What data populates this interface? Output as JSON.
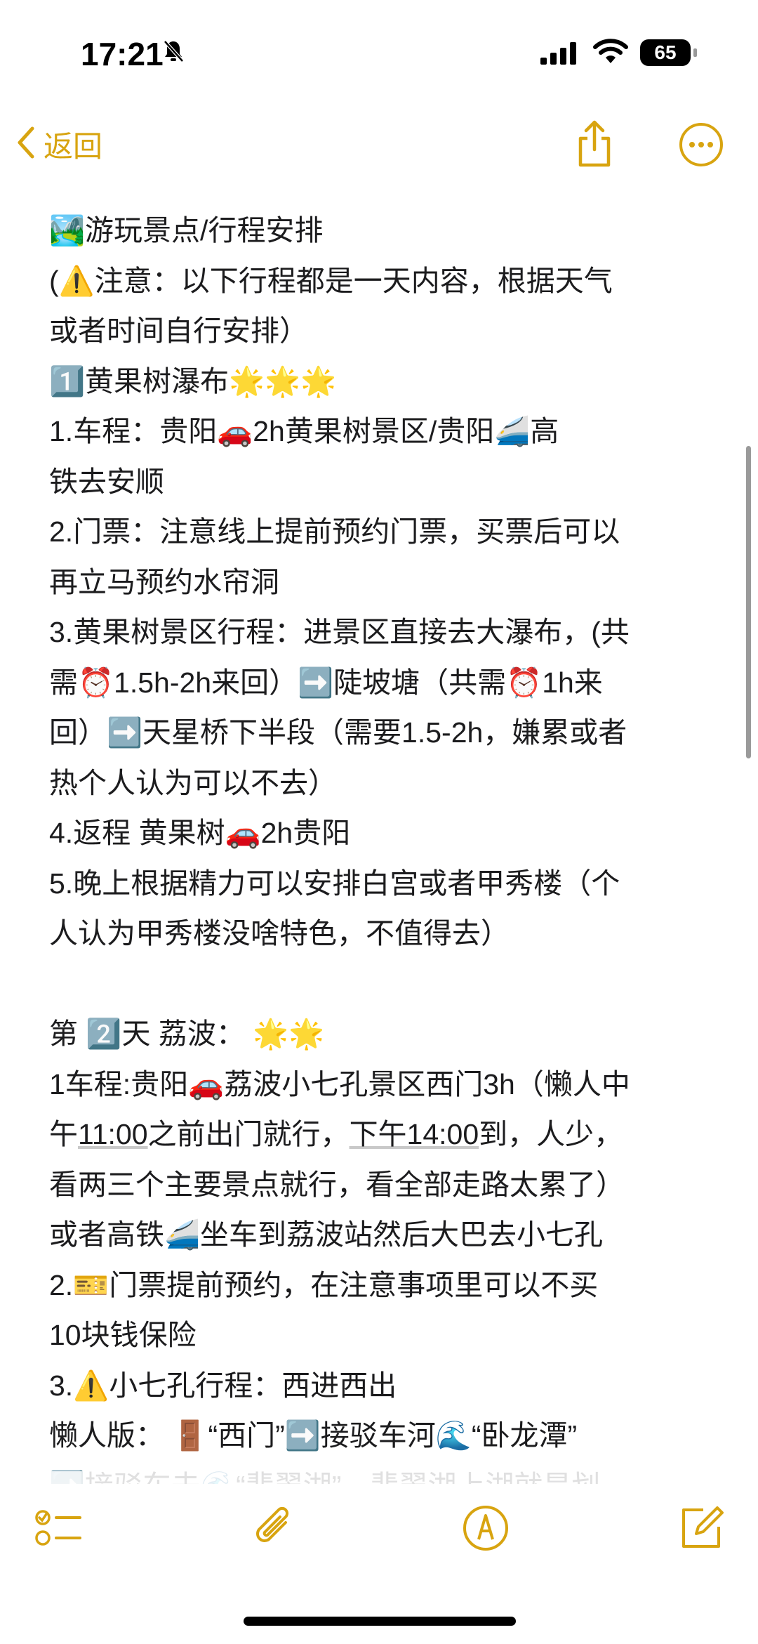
{
  "status_bar": {
    "time": "17:21",
    "battery": "65"
  },
  "nav": {
    "back_label": "返回"
  },
  "note": {
    "lines": [
      "🏞️游玩景点/行程安排",
      "(⚠️注意：以下行程都是一天内容，根据天气",
      "或者时间自行安排）",
      "1️⃣黄果树瀑布🌟🌟🌟",
      "1.车程：贵阳🚗2h黄果树景区/贵阳🚄高",
      "铁去安顺",
      "2.门票：注意线上提前预约门票，买票后可以",
      "再立马预约水帘洞",
      "3.黄果树景区行程：进景区直接去大瀑布，(共",
      "需⏰1.5h-2h来回）➡️陡坡塘（共需⏰1h来",
      "回）➡️天星桥下半段（需要1.5-2h，嫌累或者",
      "热个人认为可以不去）",
      "4.返程 黄果树🚗2h贵阳",
      "5.晚上根据精力可以安排白宫或者甲秀楼（个",
      "人认为甲秀楼没啥特色，不值得去）",
      "",
      "第 2️⃣天 荔波： 🌟🌟",
      "1车程:贵阳🚗荔波小七孔景区西门3h（懒人中",
      "__L18__",
      "看两三个主要景点就行，看全部走路太累了）",
      "或者高铁🚄坐车到荔波站然后大巴去小七孔",
      "2.🎫门票提前预约，在注意事项里可以不买",
      " 10块钱保险",
      "3.⚠️小七孔行程：西进西出",
      "懒人版： 🚪“西门”➡️接驳车河🌊“卧龙潭”",
      "➡️接驳车去🌊“翡翠湖”，翡翠湖上湖就是划"
    ],
    "line18": {
      "a": "午",
      "time1": "11:00",
      "b": "之前出门就行，",
      "time2": "下午14:00",
      "c": "到，人少，"
    }
  },
  "icons": {
    "bell": "bell-slash-icon",
    "signal": "cellular-signal-icon",
    "wifi": "wifi-icon",
    "back": "chevron-left-icon",
    "share": "share-icon",
    "more": "more-icon",
    "checklist": "checklist-icon",
    "attach": "paperclip-icon",
    "markup": "markup-pen-icon",
    "compose": "compose-icon"
  },
  "colors": {
    "accent": "#d8a410",
    "text": "#1c1c1e",
    "background": "#ffffff"
  }
}
